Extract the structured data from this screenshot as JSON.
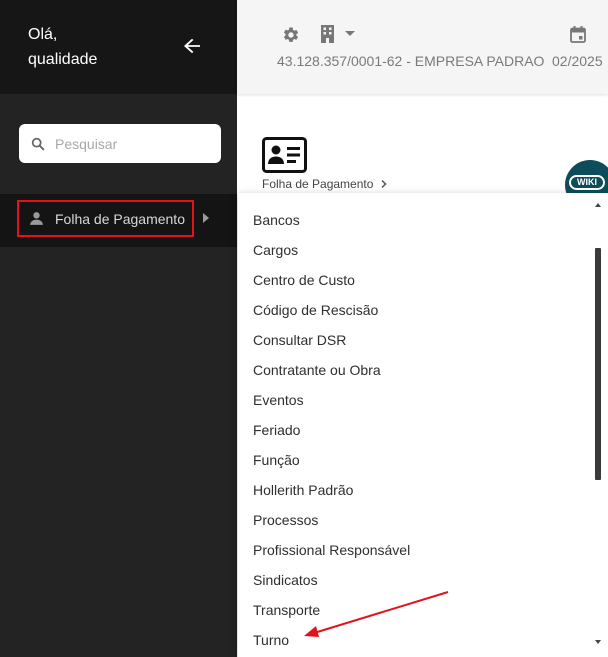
{
  "sidebar": {
    "greeting_line1": "Olá,",
    "greeting_line2": "qualidade",
    "search_placeholder": "Pesquisar",
    "menu_item_label": "Folha de Pagamento"
  },
  "topbar": {
    "company": "43.128.357/0001-62 - EMPRESA PADRAO",
    "period": "02/2025"
  },
  "main": {
    "breadcrumb": "Folha de Pagamento",
    "wiki_label": "WIKI"
  },
  "dropdown": {
    "items": [
      "Bancos",
      "Cargos",
      "Centro de Custo",
      "Código de Rescisão",
      "Consultar DSR",
      "Contratante ou Obra",
      "Eventos",
      "Feriado",
      "Função",
      "Hollerith Padrão",
      "Processos",
      "Profissional Responsável",
      "Sindicatos",
      "Transporte",
      "Turno"
    ]
  },
  "colors": {
    "sidebar_bg": "#232323",
    "sidebar_header_bg": "#161616",
    "highlight_border": "#e0141c",
    "annotation_arrow": "#e0141c",
    "wiki_bg": "#0d4c5a"
  },
  "icons": [
    "back-arrow-icon",
    "search-icon",
    "user-icon",
    "caret-right-icon",
    "gear-icon",
    "building-icon",
    "chevron-down-icon",
    "calendar-icon",
    "id-card-icon",
    "chevron-right-icon",
    "wiki-icon"
  ]
}
